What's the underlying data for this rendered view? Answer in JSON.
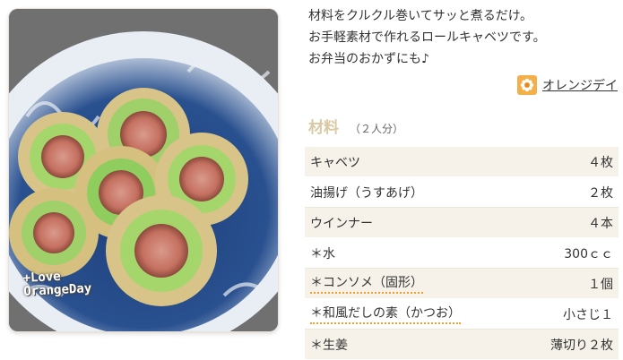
{
  "photo": {
    "watermark_line1": "+Love",
    "watermark_line2": "OrangeDay"
  },
  "description": [
    "材料をクルクル巻いてサッと煮るだけ。",
    "お手軽素材で作れるロールキャベツです。",
    "お弁当のおかずにも♪"
  ],
  "author": {
    "name": "オレンジデイ",
    "icon": "avatar-flower-icon"
  },
  "ingredients": {
    "title": "材料",
    "servings": "（２人分）",
    "items": [
      {
        "name": "キャベツ",
        "amount": "４枚",
        "link": false
      },
      {
        "name": "油揚げ（うすあげ）",
        "amount": "２枚",
        "link": false
      },
      {
        "name": "ウインナー",
        "amount": "４本",
        "link": false
      },
      {
        "name": "＊水",
        "amount": "300ｃｃ",
        "link": false
      },
      {
        "name": "＊コンソメ（固形）",
        "amount": "１個",
        "link": true
      },
      {
        "name": "＊和風だしの素（かつお）",
        "amount": "小さじ１",
        "link": true
      },
      {
        "name": "＊生姜",
        "amount": "薄切り２枚",
        "link": false
      }
    ]
  },
  "colors": {
    "accent": "#f0a030",
    "title": "#d9c8a2",
    "row_alt": "#f6f2ea"
  }
}
